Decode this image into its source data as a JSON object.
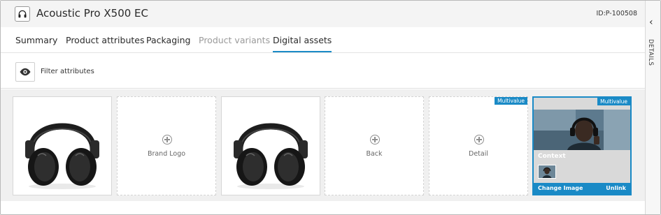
{
  "header": {
    "title": "Acoustic Pro X500 EC",
    "id_text": "ID:P-100508",
    "icon": "headphones-icon"
  },
  "tabs": [
    {
      "label": "Summary",
      "state": "normal"
    },
    {
      "label": "Product attributes",
      "state": "normal"
    },
    {
      "label": "Packaging",
      "state": "normal"
    },
    {
      "label": "Product variants",
      "state": "disabled"
    },
    {
      "label": "Digital assets",
      "state": "active"
    }
  ],
  "filter": {
    "label": "Filter attributes",
    "icon": "eye-icon"
  },
  "assets": {
    "tiles": [
      {
        "type": "image",
        "image": "headphones"
      },
      {
        "type": "empty",
        "caption": "Brand Logo"
      },
      {
        "type": "image",
        "image": "headphones"
      },
      {
        "type": "empty",
        "caption": "Back"
      },
      {
        "type": "empty",
        "caption": "Detail",
        "badge": "Multivalue"
      },
      {
        "type": "context",
        "badge": "Multivalue",
        "label": "Context",
        "change_label": "Change Image",
        "unlink_label": "Unlink"
      }
    ]
  },
  "side_panel": {
    "label": "DETAILS",
    "icon": "chevron-left-icon"
  },
  "colors": {
    "accent": "#1a8ac6",
    "header_bg": "#f4f4f4",
    "assets_bg": "#f0f0f0"
  }
}
